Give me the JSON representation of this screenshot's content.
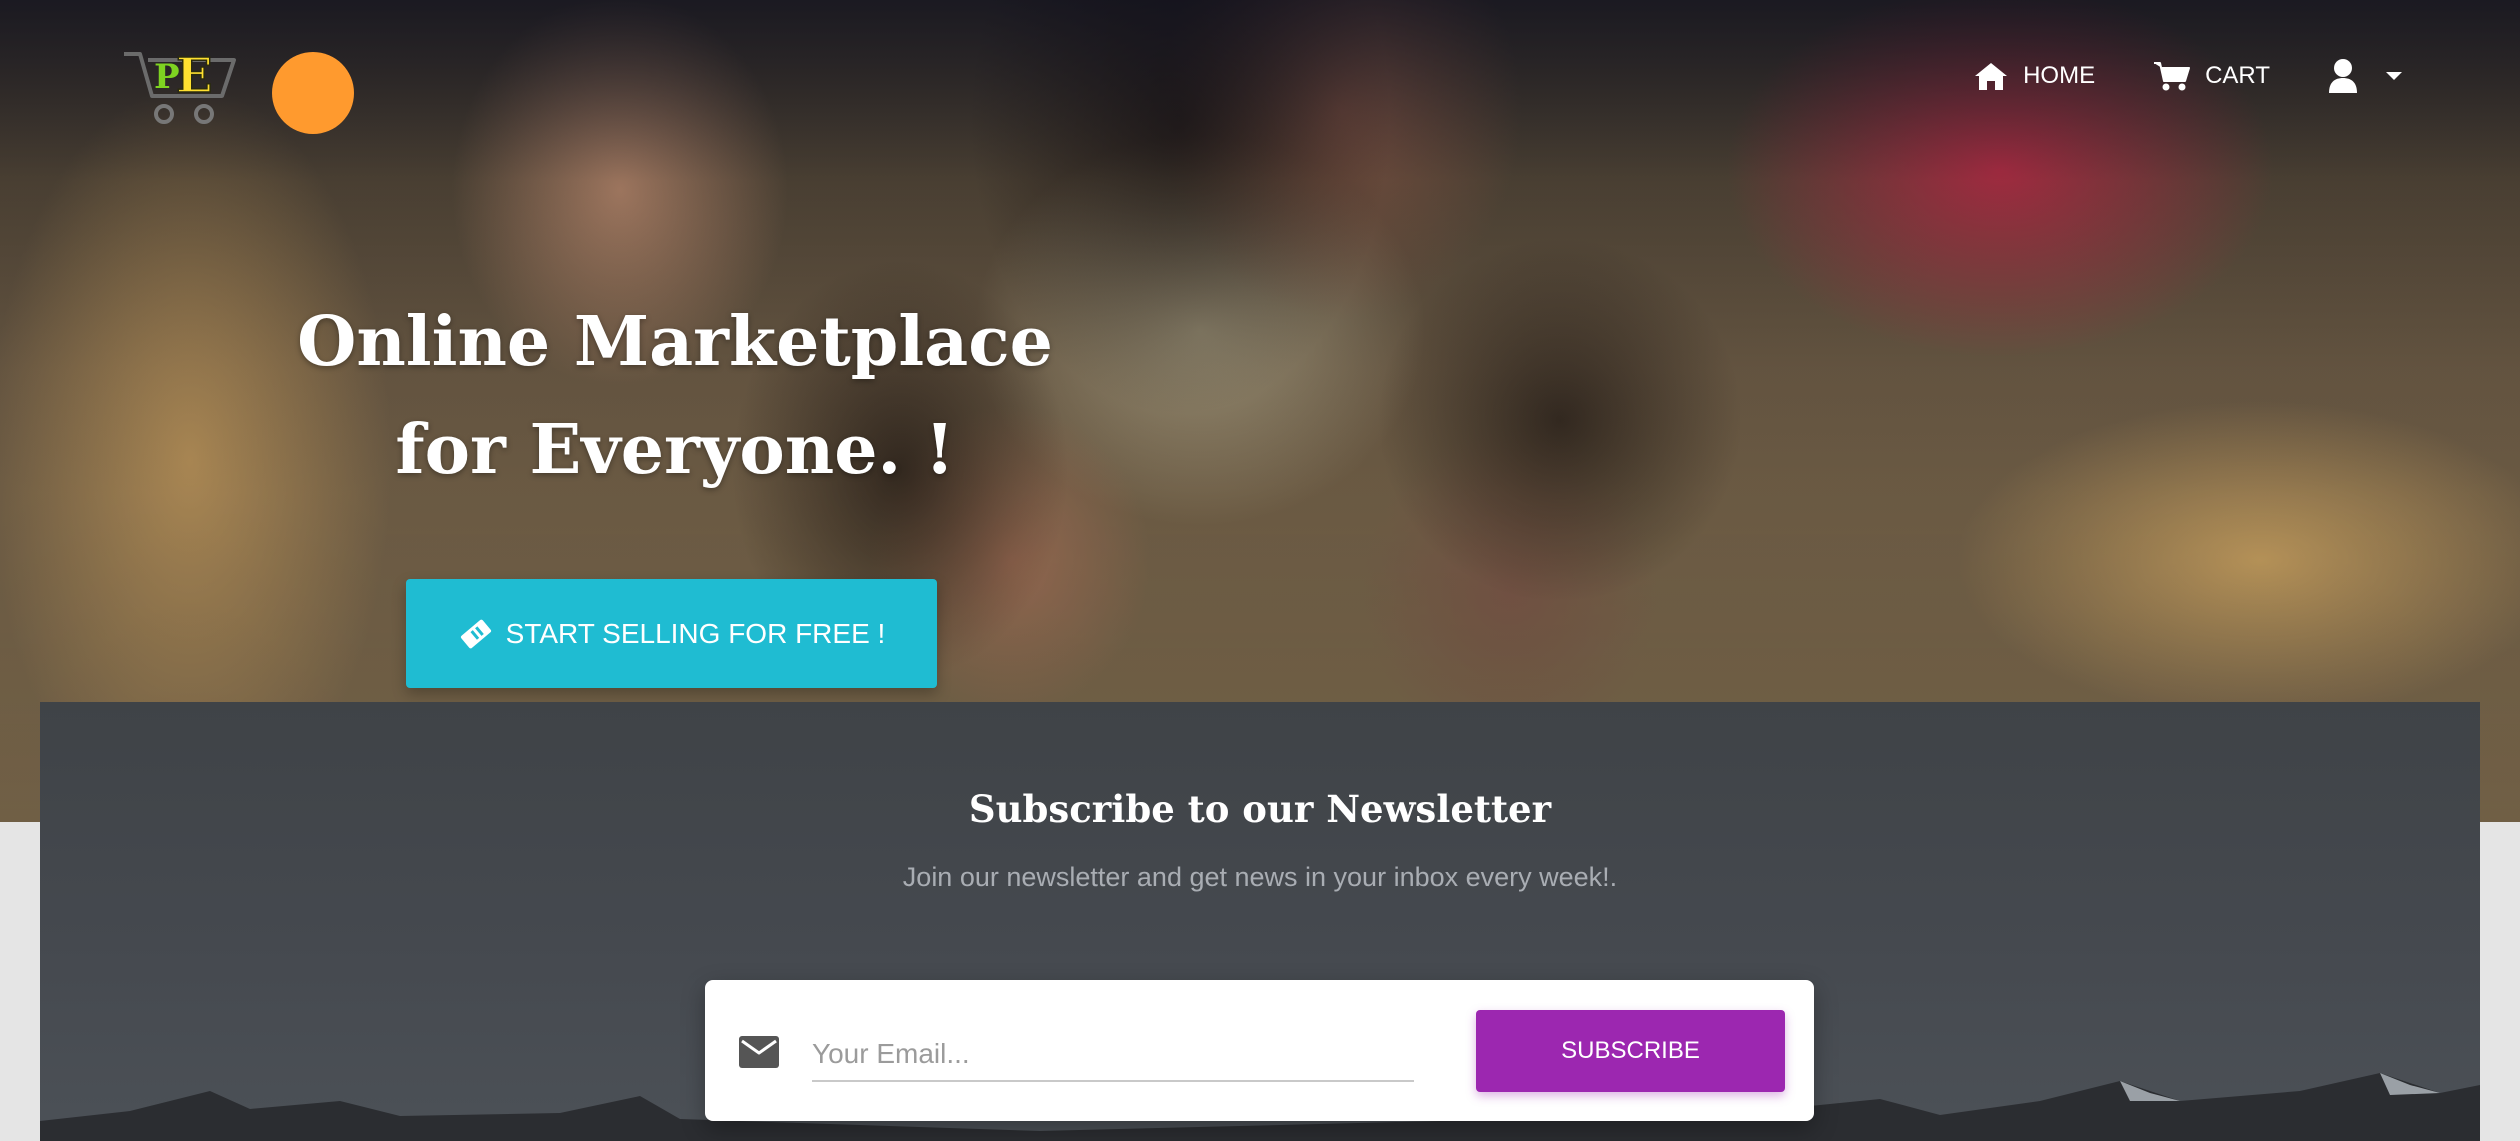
{
  "nav": {
    "home_label": "HOME",
    "cart_label": "CART",
    "account_menu": "user-icon"
  },
  "hero": {
    "title": "Online Marketplace for Everyone. !",
    "cta_label": "START SELLING FOR FREE !"
  },
  "newsletter": {
    "title": "Subscribe to our Newsletter",
    "subtitle": "Join our newsletter and get news in your inbox every week!.",
    "email_placeholder": "Your Email...",
    "subscribe_label": "SUBSCRIBE"
  },
  "colors": {
    "cta": "#1fbcd2",
    "subscribe": "#9c27b0",
    "avatar": "#ff9a2e"
  }
}
